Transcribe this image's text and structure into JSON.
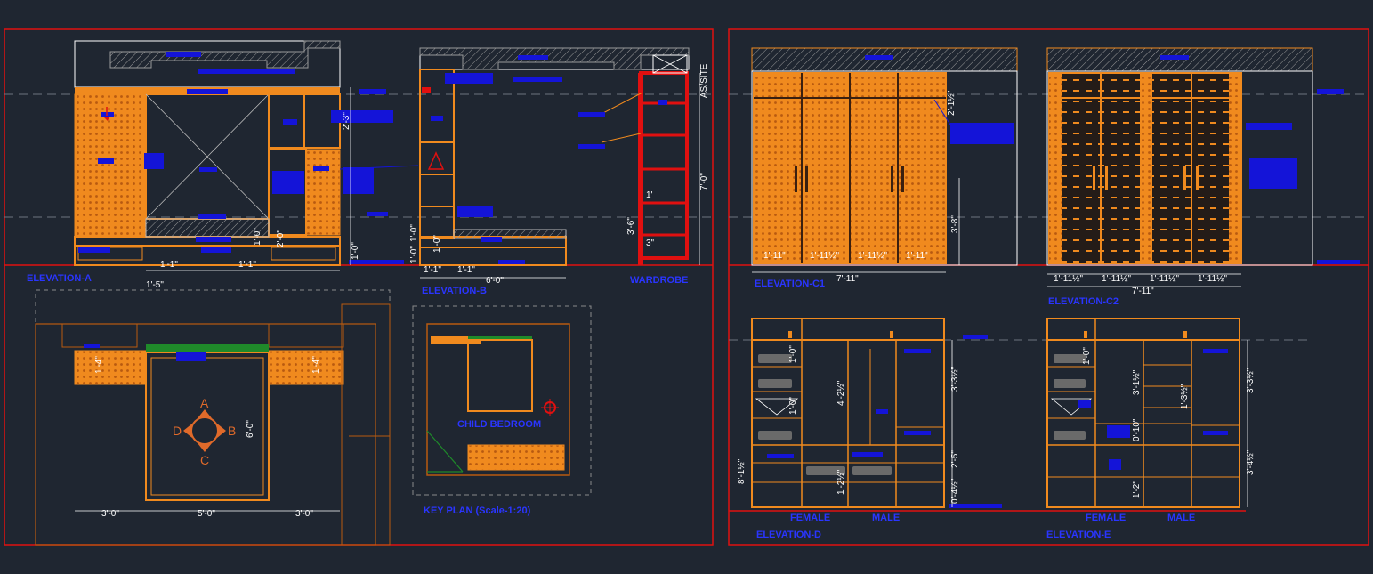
{
  "drawing": {
    "colors": {
      "background": "#1f2631",
      "frame": "#e01010",
      "furniture": "#f08a1e",
      "annotation": "#1414d8",
      "dimension": "#ffffff",
      "hatch": "#a0a0a0",
      "center_line": "#6e7480",
      "green": "#1f8a2a"
    }
  },
  "sheet1": {
    "elevation_a": {
      "title": "ELEVATION-A",
      "dims": {
        "width_left": "1'-1\"",
        "width_right": "1'-1\"",
        "top": "2'-3\"",
        "base": "1'-0\"",
        "mid": "2'-0\"",
        "shelf": "1'-0\"",
        "foot": "1'-5\""
      }
    },
    "elevation_b": {
      "title": "ELEVATION-B",
      "dims": {
        "total": "6'-0\"",
        "left": "1'-1\"",
        "right": "1'-1\"",
        "height_a": "1'-0\"",
        "height_b": "1'-0\"",
        "height_c": "1'-0\"",
        "wardrobe_label": "WARDROBE",
        "as_site": "AS/SITE",
        "full_height": "7'-0\"",
        "low": "3'-6\"",
        "top": "1'",
        "base": "3\""
      }
    },
    "plan": {
      "dims": {
        "left": "3'-0\"",
        "center": "5'-0\"",
        "right": "3'-0\"",
        "depth": "6'-0\"",
        "side_left": "1'-4\"",
        "side_right": "1'-4\""
      },
      "compass": {
        "north": "A",
        "east": "B",
        "south": "C",
        "west": "D"
      }
    },
    "key_plan": {
      "title": "KEY PLAN (Scale-1:20)",
      "room_label": "CHILD BEDROOM"
    }
  },
  "sheet2": {
    "elevation_c1": {
      "title": "ELEVATION-C1",
      "dims": {
        "total": "7'-11\"",
        "segments": [
          "1'-11\"",
          "1'-11½\"",
          "1'-11½\"",
          "1'-11\""
        ],
        "top": "2'-1½\"",
        "height": "3'-8\""
      }
    },
    "elevation_c2": {
      "title": "ELEVATION-C2",
      "dims": {
        "total": "7'-11\"",
        "segments": [
          "1'-11½\"",
          "1'-11½\"",
          "1'-11½\"",
          "1'-11½\""
        ]
      }
    },
    "elevation_d": {
      "title": "ELEVATION-D",
      "label_female": "FEMALE",
      "label_male": "MALE",
      "dims": {
        "upper": "3'-3½\"",
        "lower": "2'-5\"",
        "left": "8'-1½\"",
        "inner_a": "4'-2½\"",
        "inner_b": "1'-0\"",
        "inner_c": "1'-0\"",
        "inner_d": "1'-2½\"",
        "inner_e": "0'-4½\""
      }
    },
    "elevation_e": {
      "title": "ELEVATION-E",
      "label_female": "FEMALE",
      "label_male": "MALE",
      "dims": {
        "upper": "3'-3½\"",
        "lower": "3'-4½\"",
        "inner_a": "3'-1½\"",
        "inner_b": "1'-0\"",
        "inner_c": "1'-2\"",
        "inner_d": "1'-3½\"",
        "inner_e": "0'-10\""
      }
    }
  }
}
